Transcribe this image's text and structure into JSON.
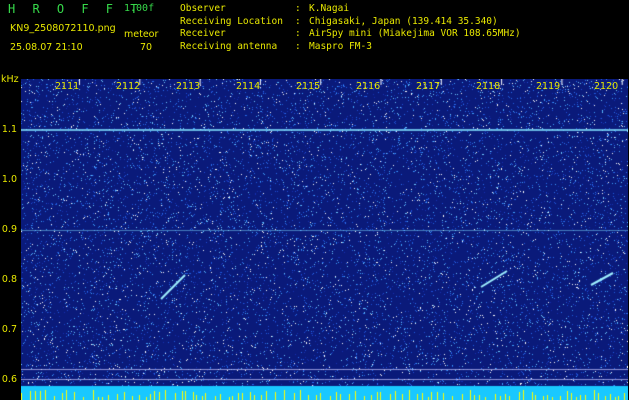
{
  "header": {
    "title": "H R O F F T",
    "version": "1.00f",
    "filename": "KN9_2508072110.png",
    "meteor_label": "meteor",
    "datetime": "25.08.07 21:10",
    "count": "70"
  },
  "info": [
    {
      "key": "Observer",
      "value": "K.Nagai"
    },
    {
      "key": "Receiving Location",
      "value": "Chigasaki, Japan (139.414 35.340)"
    },
    {
      "key": "Receiver",
      "value": "AirSpy mini (Miakejima VOR 108.65MHz)"
    },
    {
      "key": "Receiving antenna",
      "value": "Maspro FM-3"
    }
  ],
  "axis": {
    "y_unit": "kHz",
    "y_ticks": [
      "1.1",
      "1.0",
      "0.9",
      "0.8",
      "0.7",
      "0.6"
    ],
    "x_ticks": [
      "2111",
      "2112",
      "2113",
      "2114",
      "2115",
      "2116",
      "2117",
      "2118",
      "2119",
      "2120"
    ]
  },
  "colors": {
    "background": "#000000",
    "waterfall_base": "#0a1a7a",
    "noise_light": "#3fa0ff",
    "noise_white": "#ffffff",
    "carrier": "#7fe0ff",
    "bottom_bar": "#19c8ff",
    "peaks": "#ffff00",
    "labels": "#e8e800",
    "title": "#36d94a"
  }
}
